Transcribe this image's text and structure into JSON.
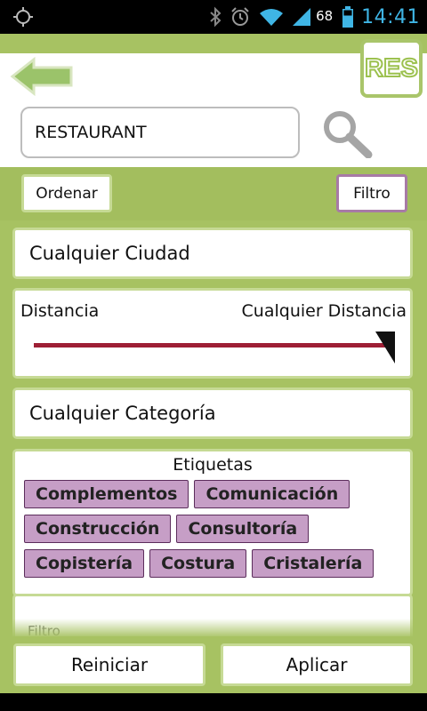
{
  "status_bar": {
    "battery_level": "68",
    "time": "14:41"
  },
  "header": {
    "logo_text": "RES",
    "search_value": "RESTAURANT",
    "back_icon": "back-arrow-icon",
    "search_icon": "magnifier-icon"
  },
  "toolbar": {
    "order_label": "Ordenar",
    "filter_label": "Filtro"
  },
  "filters": {
    "city": "Cualquier Ciudad",
    "distance_label": "Distancia",
    "distance_value": "Cualquier Distancia",
    "category": "Cualquier Categoría",
    "tags_title": "Etiquetas",
    "tags": [
      [
        "Complementos",
        "Comunicación"
      ],
      [
        "Construcción",
        "Consultoría"
      ],
      [
        "Copistería",
        "Costura",
        "Cristalería"
      ]
    ],
    "filter_placeholder": "Filtro"
  },
  "actions": {
    "reset_label": "Reiniciar",
    "apply_label": "Aplicar"
  },
  "colors": {
    "brand_green": "#a7c262",
    "tag_fill": "#c69ec6",
    "slider": "#9e1f35",
    "clock": "#3fb5e5"
  }
}
